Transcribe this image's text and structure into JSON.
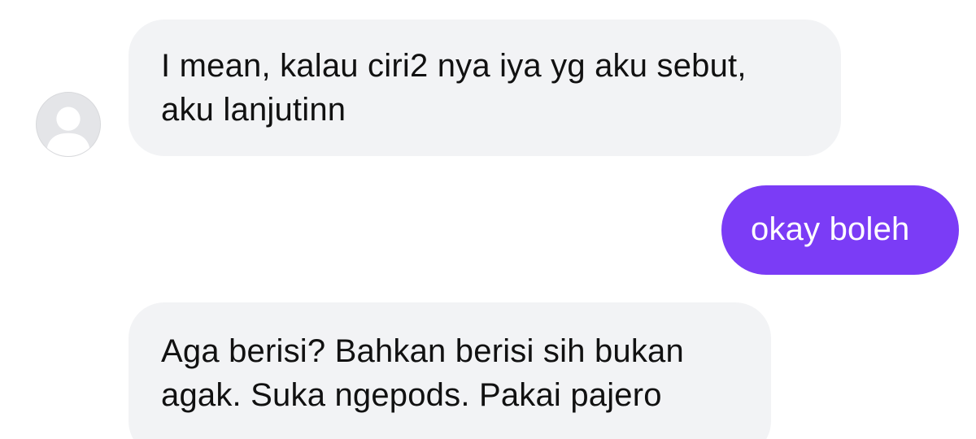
{
  "conversation": {
    "messages": [
      {
        "sender": "other",
        "lines": [
          "I mean, kalau ciri2 nya iya yg aku sebut,",
          "aku lanjutinn"
        ]
      },
      {
        "sender": "me",
        "lines": [
          "okay boleh"
        ]
      },
      {
        "sender": "other",
        "lines": [
          "Aga berisi? Bahkan berisi sih bukan",
          "agak. Suka ngepods. Pakai pajero"
        ]
      }
    ],
    "avatar_icon": "default-user-avatar-icon"
  },
  "colors": {
    "incoming_bubble": "#f2f3f5",
    "outgoing_bubble": "#7b3cf6",
    "incoming_text": "#111111",
    "outgoing_text": "#ffffff",
    "avatar_bg": "#e4e5e8",
    "avatar_figure": "#ffffff"
  }
}
